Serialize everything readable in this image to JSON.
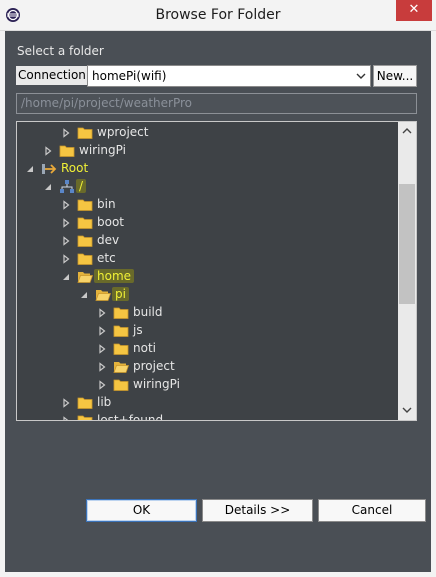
{
  "window": {
    "title": "Browse For Folder",
    "close_glyph": "✕"
  },
  "dialog": {
    "select_label": "Select a folder",
    "connection_label": "Connection:",
    "connection_value": "homePi(wifi)",
    "new_label": "New...",
    "path_value": "/home/pi/project/weatherPro"
  },
  "tree": {
    "nodes": [
      {
        "label": "wproject",
        "icon": "folder-icon",
        "expanded": false,
        "selected": false
      },
      {
        "label": "wiringPi",
        "icon": "folder-icon",
        "expanded": false,
        "selected": false
      },
      {
        "label": "Root",
        "icon": "connection-icon",
        "expanded": true,
        "selected": false
      },
      {
        "label": "/",
        "icon": "filesystem-root-icon",
        "expanded": true,
        "selected": false
      },
      {
        "label": "bin",
        "icon": "folder-icon",
        "expanded": false,
        "selected": false
      },
      {
        "label": "boot",
        "icon": "folder-icon",
        "expanded": false,
        "selected": false
      },
      {
        "label": "dev",
        "icon": "folder-icon",
        "expanded": false,
        "selected": false
      },
      {
        "label": "etc",
        "icon": "folder-icon",
        "expanded": false,
        "selected": false
      },
      {
        "label": "home",
        "icon": "folder-open-icon",
        "expanded": true,
        "selected": false
      },
      {
        "label": "pi",
        "icon": "folder-open-icon",
        "expanded": true,
        "selected": false
      },
      {
        "label": "build",
        "icon": "folder-icon",
        "expanded": false,
        "selected": false
      },
      {
        "label": "js",
        "icon": "folder-icon",
        "expanded": false,
        "selected": false
      },
      {
        "label": "noti",
        "icon": "folder-icon",
        "expanded": false,
        "selected": false
      },
      {
        "label": "project",
        "icon": "folder-open-icon",
        "expanded": false,
        "selected": false
      },
      {
        "label": "wiringPi",
        "icon": "folder-icon",
        "expanded": false,
        "selected": false
      },
      {
        "label": "lib",
        "icon": "folder-icon",
        "expanded": false,
        "selected": false
      },
      {
        "label": "lost+found",
        "icon": "folder-icon",
        "expanded": false,
        "selected": false
      }
    ]
  },
  "buttons": {
    "ok": "OK",
    "details": "Details >>",
    "cancel": "Cancel"
  },
  "colors": {
    "panel": "#4a4f55",
    "tree_bg": "#3e4246",
    "highlight": "#f0f036",
    "folder": "#f5c542",
    "close": "#c83c3c"
  }
}
